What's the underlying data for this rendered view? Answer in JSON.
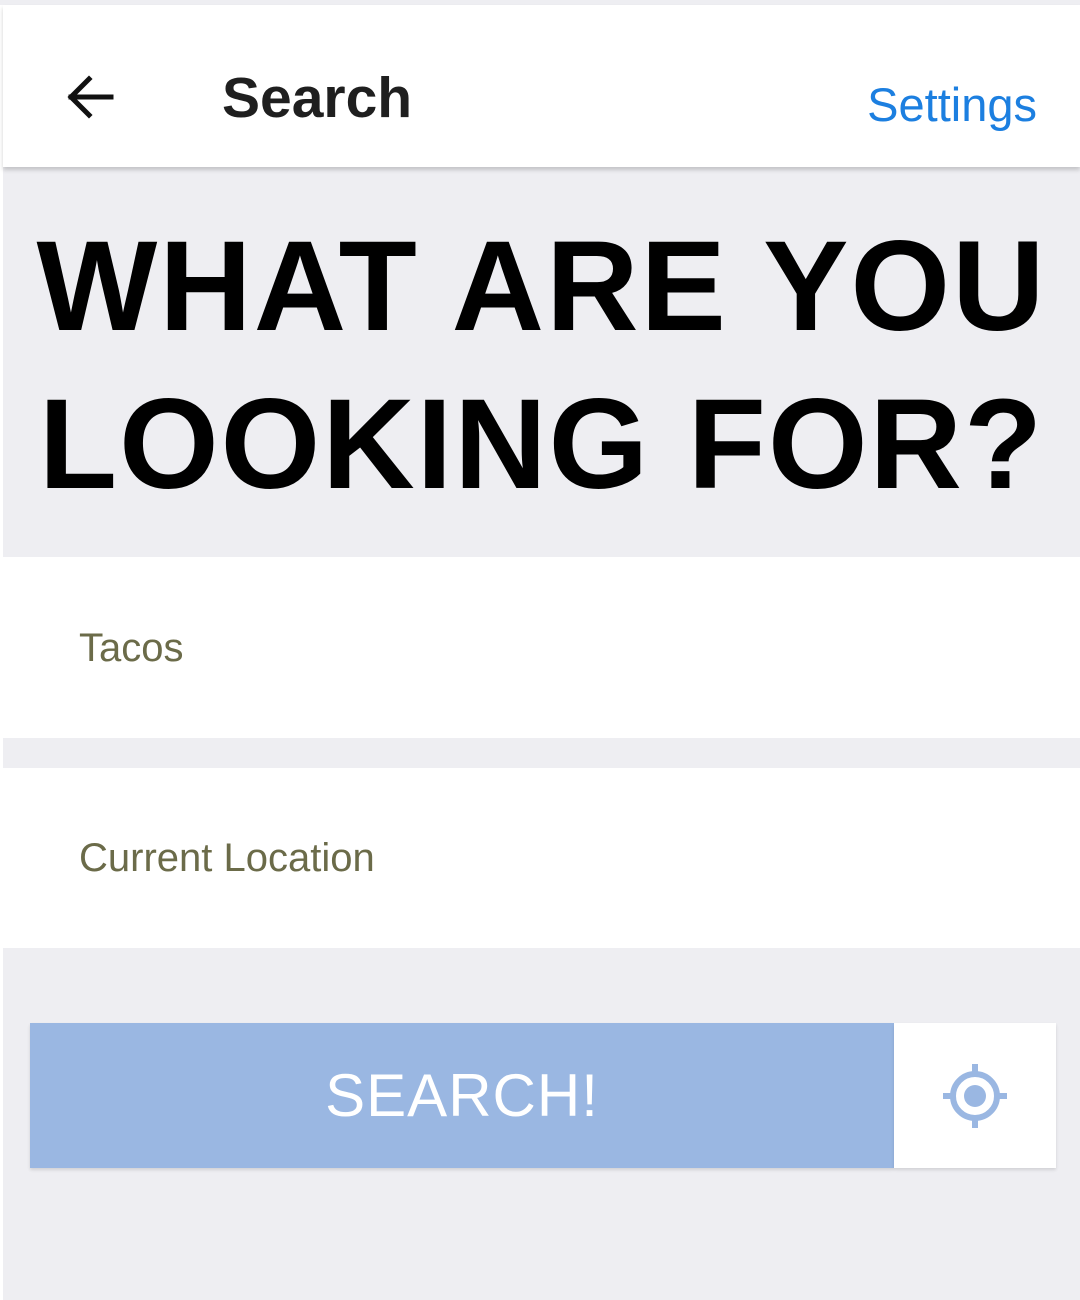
{
  "appbar": {
    "title": "Search",
    "settings_label": "Settings",
    "back_icon": "arrow-left-icon"
  },
  "hero": {
    "line1": "WHAT ARE YOU",
    "line2": "LOOKING FOR?"
  },
  "form": {
    "query_value": "Tacos",
    "location_value": "Current Location"
  },
  "actions": {
    "search_label": "SEARCH!",
    "locate_icon": "crosshair-location-icon"
  },
  "colors": {
    "accent": "#1c7fe0",
    "search_button": "#9ab7e2",
    "background": "#eeeef2",
    "field_text": "#6b6b49"
  }
}
